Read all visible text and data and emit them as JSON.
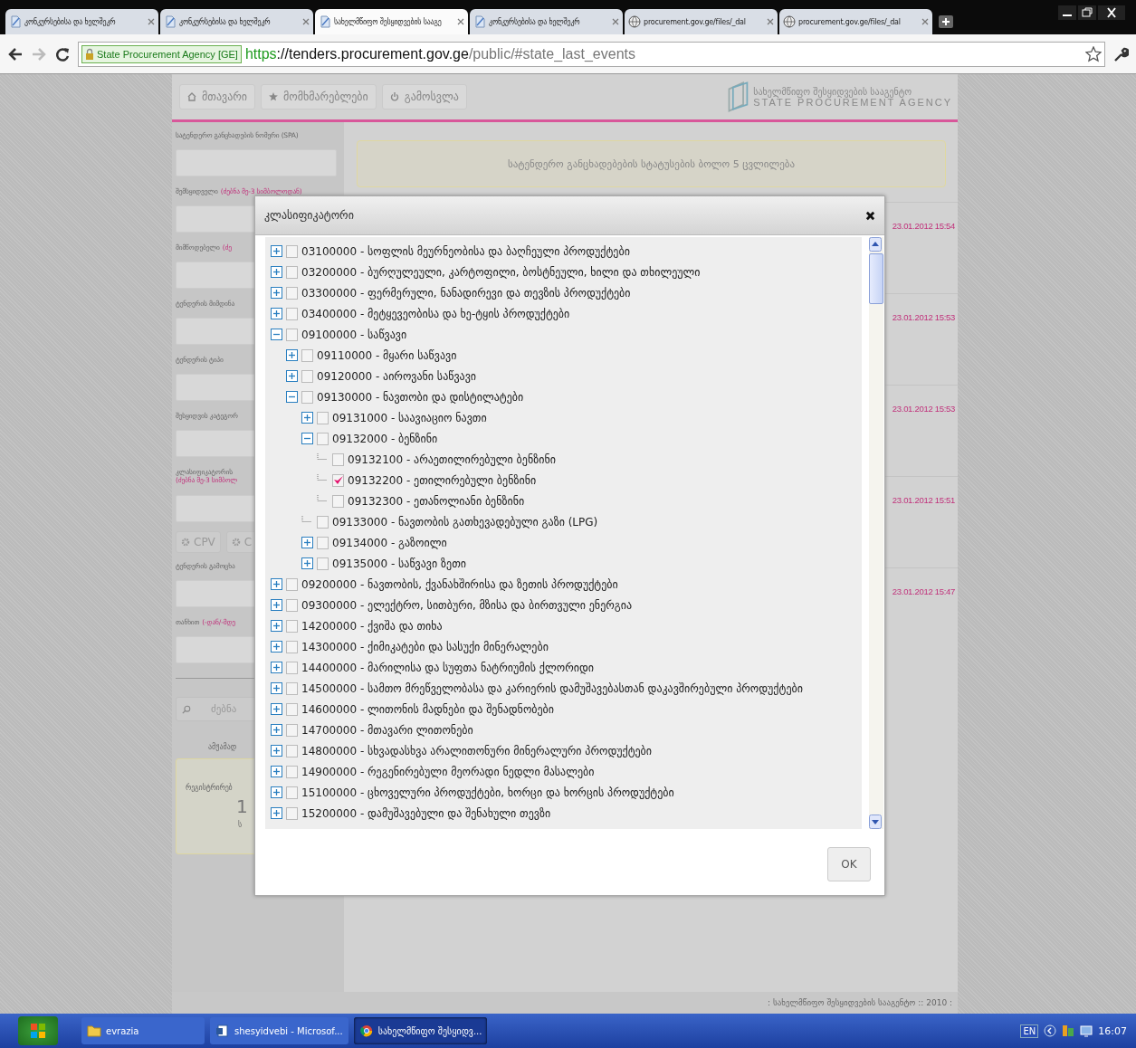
{
  "browser": {
    "tabs": [
      {
        "title": "კონკურსებისა და ხელშეკრ",
        "kind": "page",
        "selected": false
      },
      {
        "title": "კონკურსებისა და ხელშეკრ",
        "kind": "page",
        "selected": false
      },
      {
        "title": "სახელმწიფო შესყიდვების სააგე",
        "kind": "page",
        "selected": true
      },
      {
        "title": "კონკურსებისა და ხელშეკრ",
        "kind": "page",
        "selected": false
      },
      {
        "title": "procurement.gov.ge/files/_dal",
        "kind": "web",
        "selected": false
      },
      {
        "title": "procurement.gov.ge/files/_dal",
        "kind": "web",
        "selected": false
      }
    ],
    "identity": "State Procurement Agency [GE]",
    "url": {
      "scheme": "https",
      "host": "://tenders.procurement.gov.ge",
      "path": "/public/#state_last_events"
    }
  },
  "site": {
    "nav": [
      "მთავარი",
      "მომხმარებლები",
      "გამოსვლა"
    ],
    "logo": {
      "line1": "სახელმწიფო შესყიდვების სააგენტო",
      "line2": "STATE PROCUREMENT AGENCY"
    },
    "filters": [
      {
        "label": "სატენდერო განცხადების ნომერი (SPA)",
        "kind": "field"
      },
      {
        "label": "შემსყიდველი",
        "hint": "(ძებნა მე-3 სიმბოლოდან)",
        "kind": "field"
      },
      {
        "label": "მიმწოდებელი",
        "hint": "(ძე",
        "kind": "field"
      },
      {
        "label": "ტენდერის მიმდინა",
        "kind": "field"
      },
      {
        "label": "ტენდერის ტიპი",
        "kind": "field"
      },
      {
        "label": "შესყიდვის კატეგორ",
        "kind": "field"
      },
      {
        "label": "კლასიფიკატორის",
        "hint": "(ძებნა მე-3 სიმბოლ",
        "kind": "field-wrap"
      },
      {
        "kind": "buttons",
        "buttons": [
          "CPV",
          "C"
        ]
      },
      {
        "label": "ტენდერის გამოცხა",
        "kind": "field"
      },
      {
        "label": "თანხით",
        "hint": "(-დან/-მდე",
        "kind": "field"
      }
    ],
    "search_button": "ძებნა",
    "stats": {
      "heading": "ამჟამად",
      "label": "რეგისტრირებ",
      "value": "1",
      "note": "ს"
    },
    "notice": "სატენდერო განცხადებების სტატუსების ბოლო 5 ცვლილება",
    "events": [
      "23.01.2012 15:54",
      "23.01.2012 15:53",
      "23.01.2012 15:53",
      "23.01.2012 15:51",
      "23.01.2012 15:47"
    ],
    "footer": ": სახელმწიფო შესყიდვების სააგენტო :: 2010 :"
  },
  "dialog": {
    "title": "კლასიფიკატორი",
    "ok": "OK",
    "tree": [
      {
        "label": "03100000 - სოფლის მეურნეობისა და ბაღჩეული პროდუქტები",
        "kind": "branch",
        "expanded": false,
        "checked": false
      },
      {
        "label": "03200000 - ბურღულეული, კარტოფილი, ბოსტნეული, ხილი და თხილეული",
        "kind": "branch",
        "expanded": false,
        "checked": false
      },
      {
        "label": "03300000 - ფერმერული, ნანადირევი და თევზის პროდუქტები",
        "kind": "branch",
        "expanded": false,
        "checked": false
      },
      {
        "label": "03400000 - მეტყევეობისა და ხე-ტყის პროდუქტები",
        "kind": "branch",
        "expanded": false,
        "checked": false
      },
      {
        "label": "09100000 - საწვავი",
        "kind": "branch",
        "expanded": true,
        "checked": false,
        "children": [
          {
            "label": "09110000 - მყარი საწვავი",
            "kind": "branch",
            "expanded": false,
            "checked": false
          },
          {
            "label": "09120000 - აიროვანი საწვავი",
            "kind": "branch",
            "expanded": false,
            "checked": false
          },
          {
            "label": "09130000 - ნავთობი და დისტილატები",
            "kind": "branch",
            "expanded": true,
            "checked": false,
            "children": [
              {
                "label": "09131000 - საავიაციო ნავთი",
                "kind": "branch",
                "expanded": false,
                "checked": false
              },
              {
                "label": "09132000 - ბენზინი",
                "kind": "branch",
                "expanded": true,
                "checked": false,
                "children": [
                  {
                    "label": "09132100 - არაეთილირებული ბენზინი",
                    "kind": "leaf",
                    "checked": false
                  },
                  {
                    "label": "09132200 - ეთილირებული ბენზინი",
                    "kind": "leaf",
                    "checked": true
                  },
                  {
                    "label": "09132300 - ეთანოლიანი ბენზინი",
                    "kind": "leaf",
                    "checked": false
                  }
                ]
              },
              {
                "label": "09133000 - ნავთობის გათხევადებული გაზი (LPG)",
                "kind": "leaf",
                "checked": false
              },
              {
                "label": "09134000 - გაზოილი",
                "kind": "branch",
                "expanded": false,
                "checked": false
              },
              {
                "label": "09135000 - საწვავი ზეთი",
                "kind": "branch",
                "expanded": false,
                "checked": false
              }
            ]
          }
        ]
      },
      {
        "label": "09200000 - ნავთობის, ქვანახშირისა და ზეთის პროდუქტები",
        "kind": "branch",
        "expanded": false,
        "checked": false
      },
      {
        "label": "09300000 - ელექტრო, სითბური, მზისა და ბირთვული ენერგია",
        "kind": "branch",
        "expanded": false,
        "checked": false
      },
      {
        "label": "14200000 - ქვიშა და თიხა",
        "kind": "branch",
        "expanded": false,
        "checked": false
      },
      {
        "label": "14300000 - ქიმიკატები და სასუქი მინერალები",
        "kind": "branch",
        "expanded": false,
        "checked": false
      },
      {
        "label": "14400000 - მარილისა და სუფთა ნატრიუმის ქლორიდი",
        "kind": "branch",
        "expanded": false,
        "checked": false
      },
      {
        "label": "14500000 - სამთო მრეწველობასა და კარიერის დამუშავებასთან დაკავშირებული პროდუქტები",
        "kind": "branch",
        "expanded": false,
        "checked": false
      },
      {
        "label": "14600000 - ლითონის მადნები და შენადნობები",
        "kind": "branch",
        "expanded": false,
        "checked": false
      },
      {
        "label": "14700000 - მთავარი ლითონები",
        "kind": "branch",
        "expanded": false,
        "checked": false
      },
      {
        "label": "14800000 - სხვადასხვა არალითონური მინერალური პროდუქტები",
        "kind": "branch",
        "expanded": false,
        "checked": false
      },
      {
        "label": "14900000 - რეგენირებული მეორადი ნედლი მასალები",
        "kind": "branch",
        "expanded": false,
        "checked": false
      },
      {
        "label": "15100000 - ცხოველური პროდუქტები, ხორცი და ხორცის პროდუქტები",
        "kind": "branch",
        "expanded": false,
        "checked": false
      },
      {
        "label": "15200000 - დამუშავებული და შენახული თევზი",
        "kind": "branch",
        "expanded": false,
        "checked": false
      }
    ]
  },
  "taskbar": {
    "items": [
      {
        "label": "evrazia",
        "kind": "folder",
        "selected": false
      },
      {
        "label": "shesyidvebi - Microsof...",
        "kind": "doc",
        "selected": false
      },
      {
        "label": "სახელმწიფო შესყიდვ...",
        "kind": "browser",
        "selected": true
      }
    ],
    "language": "EN",
    "time": "16:07"
  }
}
